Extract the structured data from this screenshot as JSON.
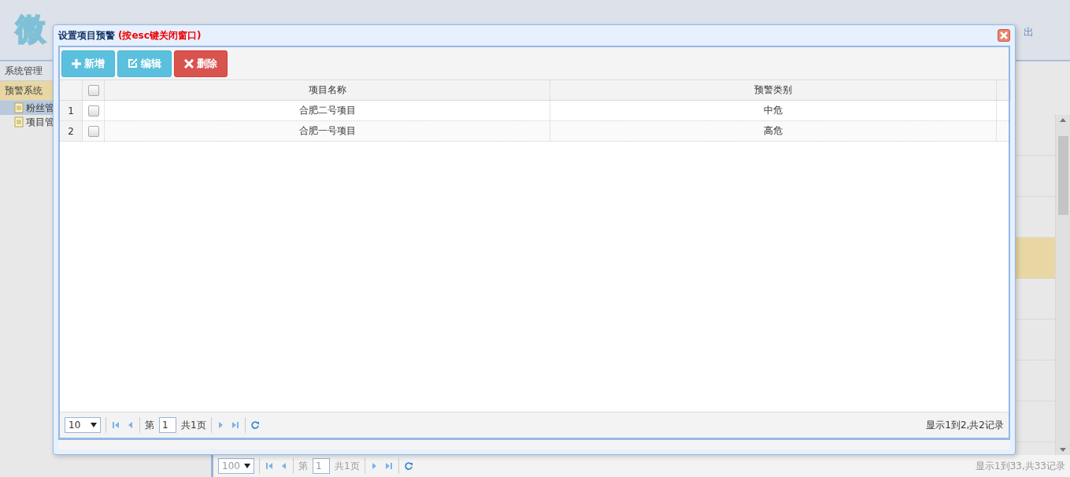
{
  "header": {
    "logo": "微",
    "logout": "出"
  },
  "sidebar": {
    "sections": [
      {
        "title": "系统管理",
        "selected": false
      },
      {
        "title": "预警系统",
        "selected": true,
        "children": [
          {
            "label": "粉丝管",
            "selected": true
          },
          {
            "label": "项目管",
            "selected": false
          }
        ]
      }
    ]
  },
  "main_grid": {
    "rows": [
      {
        "selected": false
      },
      {
        "selected": false
      },
      {
        "selected": false
      },
      {
        "selected": true
      },
      {
        "selected": false
      },
      {
        "selected": false
      },
      {
        "selected": false
      },
      {
        "selected": false
      }
    ],
    "pager": {
      "page_size": "100",
      "page_prefix": "第",
      "page": "1",
      "page_total": "共1页",
      "summary": "显示1到33,共33记录"
    }
  },
  "dialog": {
    "title": "设置项目预警",
    "hint": "(按esc键关闭窗口)",
    "toolbar": [
      {
        "kind": "add",
        "label": "新增"
      },
      {
        "kind": "edit",
        "label": "编辑"
      },
      {
        "kind": "delete",
        "label": "删除"
      }
    ],
    "table": {
      "header_checked": false,
      "columns": [
        "项目名称",
        "预警类别"
      ],
      "rows": [
        {
          "index": "1",
          "checked": false,
          "cells": [
            "合肥二号项目",
            "中危"
          ]
        },
        {
          "index": "2",
          "checked": false,
          "cells": [
            "合肥一号项目",
            "高危"
          ]
        }
      ]
    },
    "pager": {
      "page_size": "10",
      "page_prefix": "第",
      "page": "1",
      "page_total": "共1页",
      "summary": "显示1到2,共2记录"
    }
  }
}
